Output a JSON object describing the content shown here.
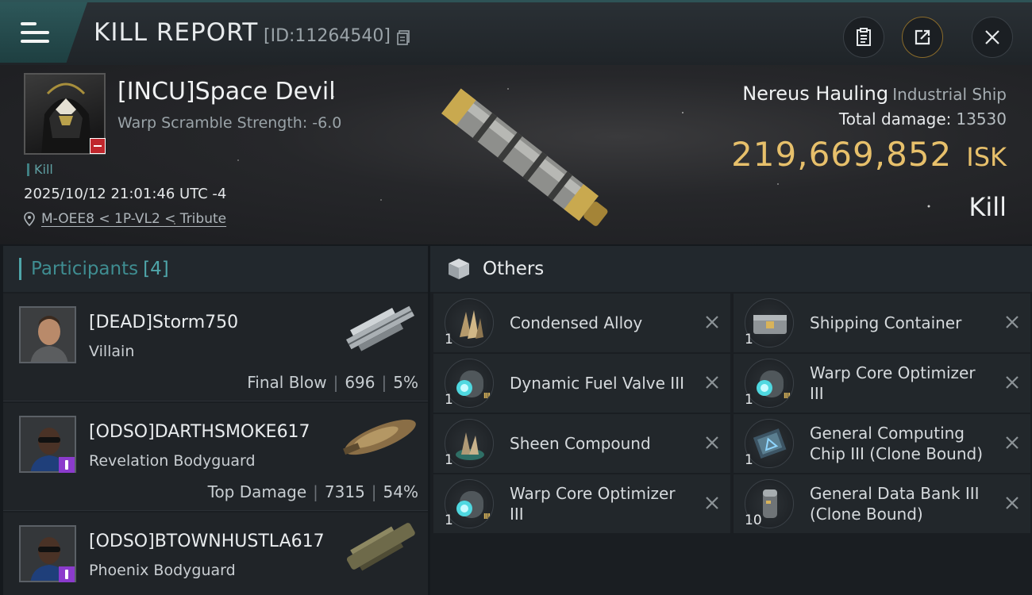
{
  "header": {
    "title": "KILL REPORT",
    "report_id": "[ID:11264540]",
    "buttons": [
      "clipboard-icon",
      "share-icon",
      "close-icon"
    ]
  },
  "victim": {
    "name": "[INCU]Space Devil",
    "warp_scramble": "Warp Scramble Strength: -6.0",
    "tag": "Kill",
    "datetime": "2025/10/12 21:01:46 UTC -4",
    "location": "M-OEE8 < 1P-VL2 < Tribute",
    "ship_name": "Nereus Hauling",
    "ship_class": "Industrial Ship",
    "total_damage_label": "Total damage:",
    "total_damage": "13530",
    "isk_value": "219,669,852",
    "isk_unit": "ISK",
    "result": "Kill"
  },
  "participants": {
    "label": "Participants",
    "count": "[4]",
    "rows": [
      {
        "name": "[DEAD]Storm750",
        "ship": "Villain",
        "role": "Final Blow",
        "damage": "696",
        "percent": "5%"
      },
      {
        "name": "[ODSO]DARTHSMOKE617",
        "ship": "Revelation Bodyguard",
        "role": "Top Damage",
        "damage": "7315",
        "percent": "54%"
      },
      {
        "name": "[ODSO]BTOWNHUSTLA617",
        "ship": "Phoenix Bodyguard",
        "role": "",
        "damage": "",
        "percent": ""
      }
    ]
  },
  "others": {
    "label": "Others",
    "items": [
      {
        "name": "Condensed Alloy",
        "qty": "1"
      },
      {
        "name": "Shipping Container",
        "qty": "1"
      },
      {
        "name": "Dynamic Fuel Valve III",
        "qty": "1"
      },
      {
        "name": "Warp Core Optimizer III",
        "qty": "1"
      },
      {
        "name": "Sheen Compound",
        "qty": "1"
      },
      {
        "name": "General Computing Chip III (Clone Bound)",
        "qty": "1"
      },
      {
        "name": "Warp Core Optimizer III",
        "qty": "1"
      },
      {
        "name": "General Data Bank III (Clone Bound)",
        "qty": "10"
      }
    ]
  },
  "colors": {
    "accent_teal": "#4fa6aa",
    "isk_gold": "#e7c06b",
    "badge_red": "#c0272d",
    "badge_purple": "#8b3bcc"
  }
}
